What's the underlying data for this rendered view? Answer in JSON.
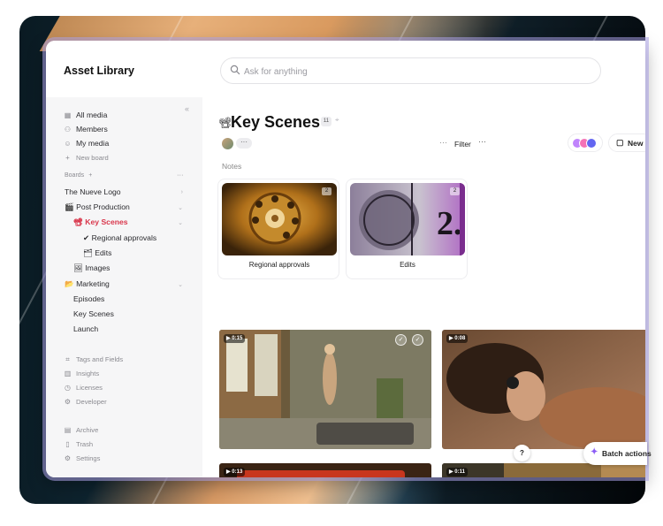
{
  "header": {
    "title": "Asset Library",
    "search_placeholder": "Ask for anything"
  },
  "sidebar": {
    "nav": [
      {
        "label": "All media",
        "icon": "grid-icon"
      },
      {
        "label": "Members",
        "icon": "person-icon"
      },
      {
        "label": "My media",
        "icon": "smile-icon"
      },
      {
        "label": "New board",
        "icon": "plus-icon"
      }
    ],
    "boards_heading": "Boards",
    "boards": [
      {
        "label": "The Nueve Logo"
      },
      {
        "label": "🎬 Post Production"
      },
      {
        "label": "📽 Key Scenes"
      },
      {
        "label": "✔ Regional approvals"
      },
      {
        "label": "🗂 Edits"
      },
      {
        "label": "🖼 Images"
      },
      {
        "label": "📂 Marketing"
      },
      {
        "label": "Episodes"
      },
      {
        "label": "Key Scenes"
      },
      {
        "label": "Launch"
      }
    ],
    "tools": [
      {
        "label": "Tags and Fields",
        "icon": "tag-icon"
      },
      {
        "label": "Insights",
        "icon": "chart-icon"
      },
      {
        "label": "Licenses",
        "icon": "license-icon"
      },
      {
        "label": "Developer",
        "icon": "developer-icon"
      }
    ],
    "footer": [
      {
        "label": "Archive",
        "icon": "archive-icon"
      },
      {
        "label": "Trash",
        "icon": "trash-icon"
      },
      {
        "label": "Settings",
        "icon": "settings-icon"
      }
    ]
  },
  "main": {
    "title_emoji": "📽",
    "title": "Key Scenes",
    "count": "11",
    "more": "···",
    "filter_label": "Filter",
    "new_label": "New",
    "notes_label": "Notes",
    "boards": [
      {
        "label": "Regional approvals",
        "count": "2"
      },
      {
        "label": "Edits",
        "count": "2"
      }
    ],
    "videos": [
      {
        "duration": "▶ 0:15"
      },
      {
        "duration": "▶ 0:08"
      },
      {
        "duration": "▶ 0:13"
      },
      {
        "duration": "▶ 0:11"
      }
    ],
    "help_label": "?",
    "batch_label": "Batch actions"
  },
  "colors": {
    "accent_active": "#d9364b",
    "batch_icon": "#8b5cf6"
  }
}
